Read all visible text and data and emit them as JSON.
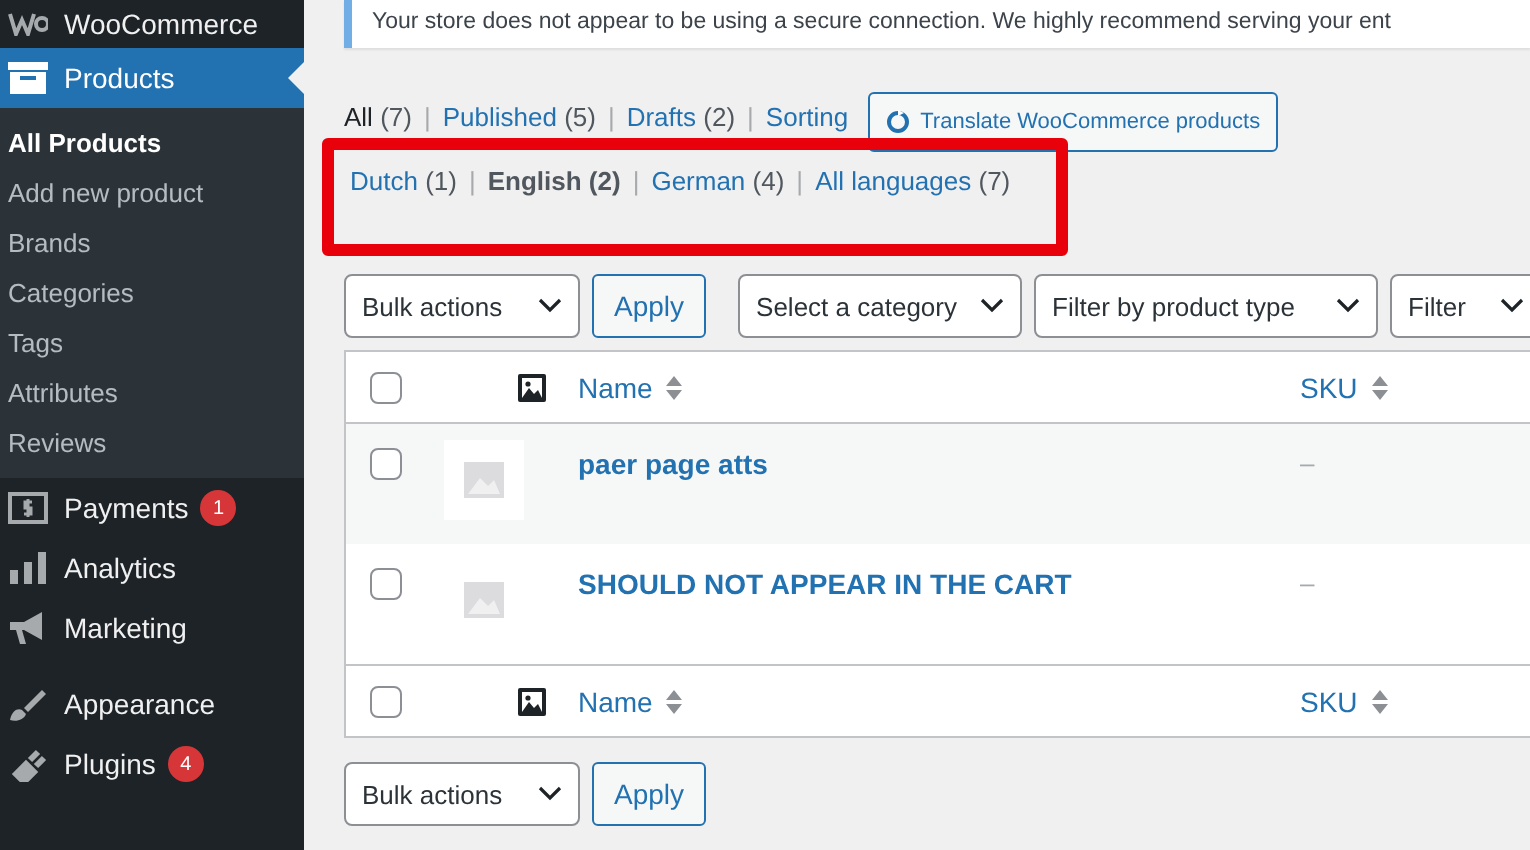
{
  "sidebar": {
    "items": [
      {
        "label": "WooCommerce",
        "selected": false
      },
      {
        "label": "Products",
        "selected": true,
        "children": [
          {
            "label": "All Products",
            "selected": true
          },
          {
            "label": "Add new product",
            "selected": false
          },
          {
            "label": "Brands",
            "selected": false
          },
          {
            "label": "Categories",
            "selected": false
          },
          {
            "label": "Tags",
            "selected": false
          },
          {
            "label": "Attributes",
            "selected": false
          },
          {
            "label": "Reviews",
            "selected": false
          }
        ]
      },
      {
        "label": "Payments",
        "selected": false,
        "badge": "1"
      },
      {
        "label": "Analytics",
        "selected": false
      },
      {
        "label": "Marketing",
        "selected": false
      },
      {
        "label": "Appearance",
        "selected": false
      },
      {
        "label": "Plugins",
        "selected": false,
        "badge": "4"
      }
    ]
  },
  "notice": {
    "text": "Your store does not appear to be using a secure connection. We highly recommend serving your ent"
  },
  "status_filters": [
    {
      "label": "All",
      "count": "(7)",
      "selected": true
    },
    {
      "separator": "|",
      "label": "Published",
      "count": "(5)",
      "selected": false
    },
    {
      "separator": "|",
      "label": "Drafts",
      "count": "(2)",
      "selected": false
    },
    {
      "separator": "|",
      "label": "Sorting",
      "selected": false
    }
  ],
  "translate_button": "Translate WooCommerce products",
  "language_filters": [
    {
      "label": "Dutch",
      "count": "(1)",
      "selected": false
    },
    {
      "separator": "|",
      "label": "English",
      "count": "(2)",
      "selected": true
    },
    {
      "separator": "|",
      "label": "German",
      "count": "(4)",
      "selected": false
    },
    {
      "separator": "|",
      "label": "All languages",
      "count": "(7)",
      "selected": false
    }
  ],
  "top_toolbar": {
    "bulk_actions": "Bulk actions",
    "apply": "Apply",
    "filters": [
      "Select a category",
      "Filter by product type",
      "Filter"
    ]
  },
  "table": {
    "header": {
      "checked": false,
      "columns": [
        "Name",
        "SKU"
      ]
    },
    "rows": [
      {
        "name": "paer page atts",
        "sku": "–",
        "checked": false
      },
      {
        "name": "SHOULD NOT APPEAR IN THE CART",
        "sku": "–",
        "checked": false
      }
    ],
    "footer": {
      "checked": false,
      "columns": [
        "Name",
        "SKU"
      ]
    }
  },
  "bottom_toolbar": {
    "bulk_actions": "Bulk actions",
    "apply": "Apply"
  }
}
